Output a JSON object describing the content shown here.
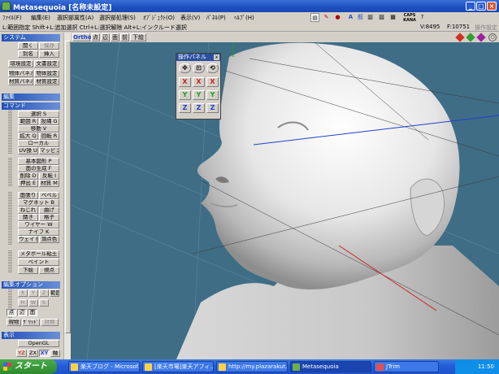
{
  "title": "Metasequoia [名称未設定]",
  "menu": [
    "ﾌｧｲﾙ(F)",
    "編集(E)",
    "選択部属性(A)",
    "選択部処理(S)",
    "ｵﾌﾞｼﾞｪｸﾄ(O)",
    "表示(V)",
    "ﾊﾟﾈﾙ(P)",
    "ﾍﾙﾌﾟ(H)"
  ],
  "status": {
    "hint": "L:範囲指定  Shift+L:追加選択  Ctrl+L:選択解除  Alt+L:インクルード選択",
    "vertices": "V:8495",
    "faces": "F:10751",
    "help_hint": "操作設定"
  },
  "tray_top": {
    "caps": "CAPS",
    "kana": "KANA"
  },
  "sections": {
    "system": "システム",
    "edit": "編集",
    "command": "コマンド",
    "edit_option": "編集オプション",
    "display": "表示"
  },
  "system_buttons": [
    "開く",
    "保存",
    "別名",
    "挿入",
    "環境設定",
    "文書設定",
    "物体パネル",
    "物体設定",
    "材質パネル",
    "材質設定"
  ],
  "command_buttons": [
    "選択 S",
    "範囲 R",
    "投縄 G",
    "移動 V",
    "拡大 Q",
    "回転 R",
    "ローカル",
    "UV操 U",
    "マッピング",
    "基本図形 P",
    "面の生成 F",
    "削除 D",
    "反転 I",
    "押出 E",
    "材質 M",
    "面張り",
    "ベベル",
    "マグネット B",
    "ねじれ",
    "曲げ",
    "錆き",
    "格子",
    "ワイヤー W",
    "ナイフ K",
    "ウェイト",
    "頂点色",
    "メタボール粘土",
    "ペイント",
    "下絵",
    "視点"
  ],
  "option_buttons": [
    "X",
    "Y",
    "Z",
    "範囲",
    "H",
    "W",
    "S",
    "点",
    "辺",
    "面",
    "現物",
    "ｸﾞﾘｯﾄﾞ",
    "対称"
  ],
  "display_buttons": [
    "OpenGL",
    "YZ",
    "ZX",
    "XY",
    "軸"
  ],
  "view_toolbar": [
    "Ortho",
    "点",
    "辺",
    "面",
    "前",
    "下絵"
  ],
  "panel": {
    "title": "操作パネル",
    "rows": [
      [
        "✥",
        "⊡",
        "⟲"
      ],
      [
        "X",
        "X",
        "X"
      ],
      [
        "Y",
        "Y",
        "Y"
      ],
      [
        "Z",
        "Z",
        "Z"
      ]
    ]
  },
  "taskbar": {
    "start": "スタート",
    "tasks": [
      "楽天ブログ - Microsof...",
      "[楽天市場]楽天アフィ...",
      "http://my.plazarakut...",
      "Metasequoia",
      "JTrim"
    ],
    "clock": "11:50"
  },
  "colors": {
    "viewport_bg": "#3f6d86",
    "title_bar": "#1d4fc0",
    "x_axis": "#d02020",
    "y_axis": "#20a020",
    "z_axis": "#2040d0"
  }
}
